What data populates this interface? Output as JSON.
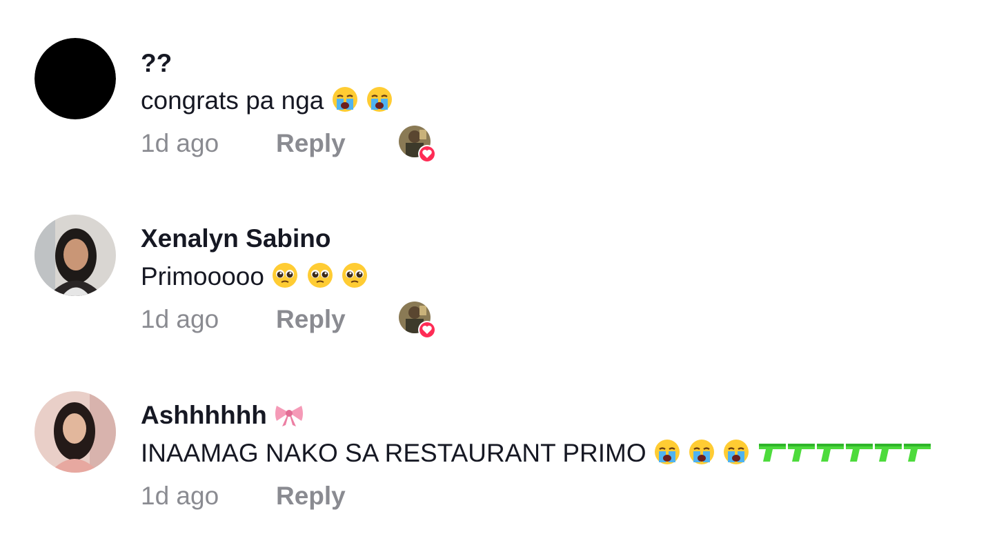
{
  "comments": [
    {
      "username": "??",
      "text": "congrats pa nga",
      "emojis": [
        "loudly-crying-face",
        "loudly-crying-face"
      ],
      "time": "1d ago",
      "reply_label": "Reply",
      "liked_by_creator": true
    },
    {
      "username": "Xenalyn Sabino",
      "text": "Primooooo",
      "emojis": [
        "pleading-face",
        "pleading-face",
        "pleading-face"
      ],
      "time": "1d ago",
      "reply_label": "Reply",
      "liked_by_creator": true
    },
    {
      "username": "Ashhhhhh",
      "username_emoji": "ribbon",
      "text": "INAAMAG NAKO SA RESTAURANT PRIMO",
      "emojis": [
        "loudly-crying-face",
        "loudly-crying-face",
        "loudly-crying-face",
        "water-pistol",
        "water-pistol",
        "water-pistol",
        "water-pistol",
        "water-pistol",
        "water-pistol"
      ],
      "time": "1d ago",
      "reply_label": "Reply",
      "liked_by_creator": false
    }
  ],
  "colors": {
    "text": "#161823",
    "muted": "#8a8b91",
    "heart_badge": "#fe2c55"
  }
}
